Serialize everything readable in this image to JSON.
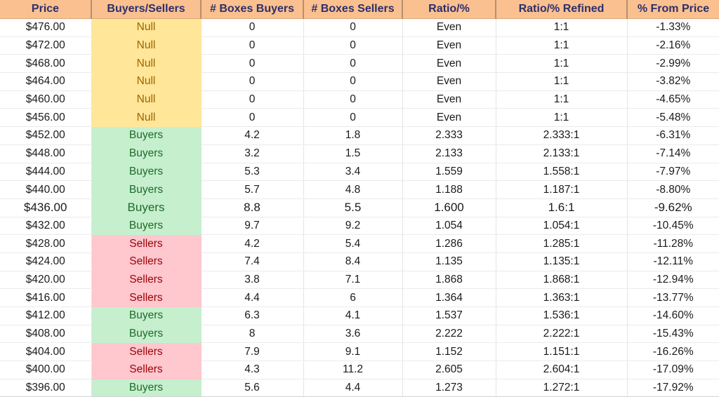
{
  "table": {
    "headers": [
      "Price",
      "Buyers/Sellers",
      "# Boxes Buyers",
      "# Boxes Sellers",
      "Ratio/%",
      "Ratio/% Refined",
      "% From Price"
    ],
    "colors": {
      "header_background": "#FAC090",
      "header_text": "#2D2F6B",
      "null_background": "#FFE699",
      "null_text": "#9C6500",
      "buyers_background": "#C6EFCE",
      "buyers_text": "#1E6B29",
      "sellers_background": "#FFC7CE",
      "sellers_text": "#9C0006",
      "cell_background": "#FFFFFF",
      "cell_text": "#1A1A1A"
    },
    "rows": [
      {
        "price": "$476.00",
        "status": "Null",
        "boxes_buyers": "0",
        "boxes_sellers": "0",
        "ratio": "Even",
        "ratio_refined": "1:1",
        "from_price": "-1.33%",
        "emphasis": false
      },
      {
        "price": "$472.00",
        "status": "Null",
        "boxes_buyers": "0",
        "boxes_sellers": "0",
        "ratio": "Even",
        "ratio_refined": "1:1",
        "from_price": "-2.16%",
        "emphasis": false
      },
      {
        "price": "$468.00",
        "status": "Null",
        "boxes_buyers": "0",
        "boxes_sellers": "0",
        "ratio": "Even",
        "ratio_refined": "1:1",
        "from_price": "-2.99%",
        "emphasis": false
      },
      {
        "price": "$464.00",
        "status": "Null",
        "boxes_buyers": "0",
        "boxes_sellers": "0",
        "ratio": "Even",
        "ratio_refined": "1:1",
        "from_price": "-3.82%",
        "emphasis": false
      },
      {
        "price": "$460.00",
        "status": "Null",
        "boxes_buyers": "0",
        "boxes_sellers": "0",
        "ratio": "Even",
        "ratio_refined": "1:1",
        "from_price": "-4.65%",
        "emphasis": false
      },
      {
        "price": "$456.00",
        "status": "Null",
        "boxes_buyers": "0",
        "boxes_sellers": "0",
        "ratio": "Even",
        "ratio_refined": "1:1",
        "from_price": "-5.48%",
        "emphasis": false
      },
      {
        "price": "$452.00",
        "status": "Buyers",
        "boxes_buyers": "4.2",
        "boxes_sellers": "1.8",
        "ratio": "2.333",
        "ratio_refined": "2.333:1",
        "from_price": "-6.31%",
        "emphasis": false
      },
      {
        "price": "$448.00",
        "status": "Buyers",
        "boxes_buyers": "3.2",
        "boxes_sellers": "1.5",
        "ratio": "2.133",
        "ratio_refined": "2.133:1",
        "from_price": "-7.14%",
        "emphasis": false
      },
      {
        "price": "$444.00",
        "status": "Buyers",
        "boxes_buyers": "5.3",
        "boxes_sellers": "3.4",
        "ratio": "1.559",
        "ratio_refined": "1.558:1",
        "from_price": "-7.97%",
        "emphasis": false
      },
      {
        "price": "$440.00",
        "status": "Buyers",
        "boxes_buyers": "5.7",
        "boxes_sellers": "4.8",
        "ratio": "1.188",
        "ratio_refined": "1.187:1",
        "from_price": "-8.80%",
        "emphasis": false
      },
      {
        "price": "$436.00",
        "status": "Buyers",
        "boxes_buyers": "8.8",
        "boxes_sellers": "5.5",
        "ratio": "1.600",
        "ratio_refined": "1.6:1",
        "from_price": "-9.62%",
        "emphasis": true
      },
      {
        "price": "$432.00",
        "status": "Buyers",
        "boxes_buyers": "9.7",
        "boxes_sellers": "9.2",
        "ratio": "1.054",
        "ratio_refined": "1.054:1",
        "from_price": "-10.45%",
        "emphasis": false
      },
      {
        "price": "$428.00",
        "status": "Sellers",
        "boxes_buyers": "4.2",
        "boxes_sellers": "5.4",
        "ratio": "1.286",
        "ratio_refined": "1.285:1",
        "from_price": "-11.28%",
        "emphasis": false
      },
      {
        "price": "$424.00",
        "status": "Sellers",
        "boxes_buyers": "7.4",
        "boxes_sellers": "8.4",
        "ratio": "1.135",
        "ratio_refined": "1.135:1",
        "from_price": "-12.11%",
        "emphasis": false
      },
      {
        "price": "$420.00",
        "status": "Sellers",
        "boxes_buyers": "3.8",
        "boxes_sellers": "7.1",
        "ratio": "1.868",
        "ratio_refined": "1.868:1",
        "from_price": "-12.94%",
        "emphasis": false
      },
      {
        "price": "$416.00",
        "status": "Sellers",
        "boxes_buyers": "4.4",
        "boxes_sellers": "6",
        "ratio": "1.364",
        "ratio_refined": "1.363:1",
        "from_price": "-13.77%",
        "emphasis": false
      },
      {
        "price": "$412.00",
        "status": "Buyers",
        "boxes_buyers": "6.3",
        "boxes_sellers": "4.1",
        "ratio": "1.537",
        "ratio_refined": "1.536:1",
        "from_price": "-14.60%",
        "emphasis": false
      },
      {
        "price": "$408.00",
        "status": "Buyers",
        "boxes_buyers": "8",
        "boxes_sellers": "3.6",
        "ratio": "2.222",
        "ratio_refined": "2.222:1",
        "from_price": "-15.43%",
        "emphasis": false
      },
      {
        "price": "$404.00",
        "status": "Sellers",
        "boxes_buyers": "7.9",
        "boxes_sellers": "9.1",
        "ratio": "1.152",
        "ratio_refined": "1.151:1",
        "from_price": "-16.26%",
        "emphasis": false
      },
      {
        "price": "$400.00",
        "status": "Sellers",
        "boxes_buyers": "4.3",
        "boxes_sellers": "11.2",
        "ratio": "2.605",
        "ratio_refined": "2.604:1",
        "from_price": "-17.09%",
        "emphasis": false
      },
      {
        "price": "$396.00",
        "status": "Buyers",
        "boxes_buyers": "5.6",
        "boxes_sellers": "4.4",
        "ratio": "1.273",
        "ratio_refined": "1.272:1",
        "from_price": "-17.92%",
        "emphasis": false
      }
    ]
  }
}
